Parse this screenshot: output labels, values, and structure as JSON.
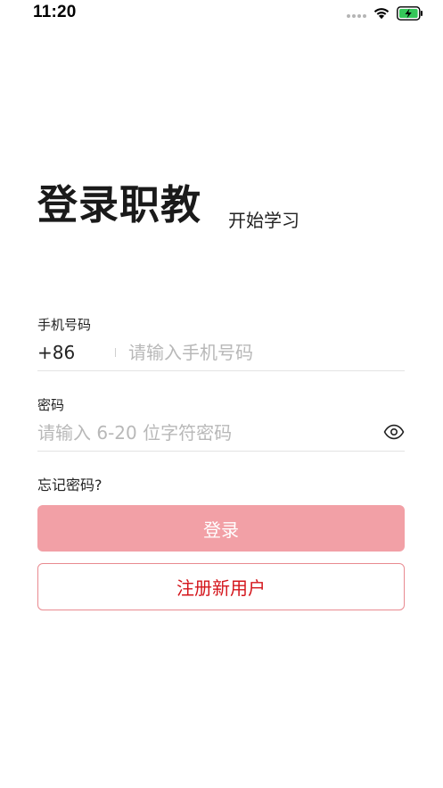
{
  "status_bar": {
    "time": "11:20",
    "icons": [
      "signal-dots",
      "wifi-icon",
      "battery-charging-icon"
    ]
  },
  "header": {
    "title": "登录职教",
    "subtitle": "开始学习"
  },
  "form": {
    "phone": {
      "label": "手机号码",
      "country_code": "+86",
      "placeholder": "请输入手机号码",
      "value": ""
    },
    "password": {
      "label": "密码",
      "placeholder": "请输入 6-20 位字符密码",
      "value": "",
      "toggle_icon": "eye-icon"
    },
    "forgot_password": "忘记密码?"
  },
  "actions": {
    "login_label": "登录",
    "register_label": "注册新用户"
  },
  "colors": {
    "accent": "#d4161c",
    "login_button_bg": "#f2a0a6",
    "register_border": "#e98a90",
    "placeholder": "#b8b8b8",
    "divider": "#e3e3e3",
    "battery_green": "#35c759"
  }
}
